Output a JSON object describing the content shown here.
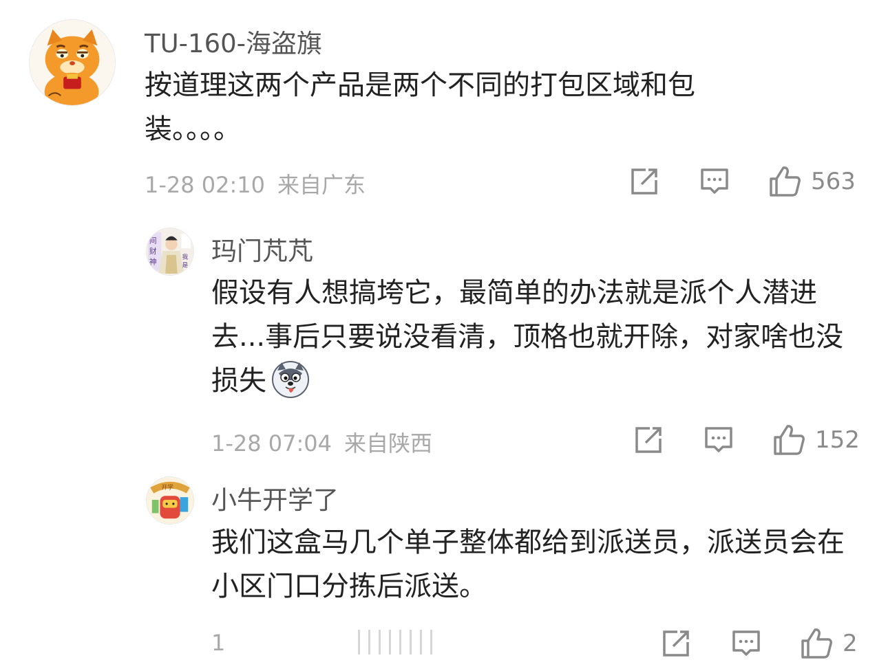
{
  "comments": [
    {
      "username": "TU-160-海盗旗",
      "text": "按道理这两个产品是两个不同的打包区域和包装。。。。",
      "time": "1-28 02:10",
      "location": "来自广东",
      "likes": "563"
    },
    {
      "username": "玛门芃芃",
      "text": "假设有人想搞垮它，最简单的办法就是派个人潜进去...事后只要说没看清，顶格也就开除，对家啥也没损失",
      "emoji": "husky-emoji",
      "time": "1-28 07:04",
      "location": "来自陕西",
      "likes": "152"
    },
    {
      "username": "小牛开学了",
      "text": "我们这盒马几个单子整体都给到派送员，派送员会在小区门口分拣后派送。",
      "time": "1",
      "location": "",
      "likes": "2"
    }
  ],
  "icons": {
    "share": "share-icon",
    "reply": "comment-icon",
    "like": "thumbs-up-icon"
  },
  "colors": {
    "username": "#555555",
    "text": "#222222",
    "meta": "#a8a8a8",
    "icon": "#8a8a8a"
  }
}
